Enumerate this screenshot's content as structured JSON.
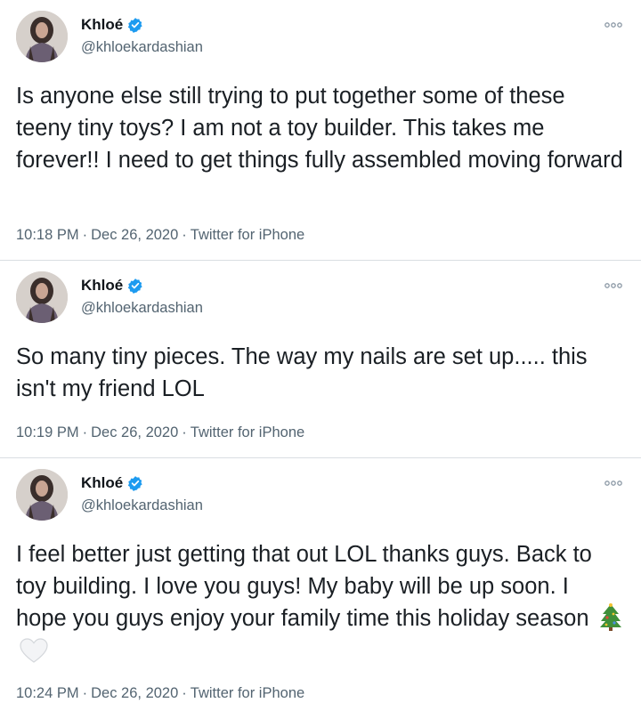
{
  "tweets": [
    {
      "author": "Khloé",
      "handle": "@khloekardashian",
      "text": "Is anyone else still trying to put together some of these teeny tiny toys? I am not a toy builder. This takes me forever!! I need to get things fully assembled moving forward",
      "time": "10:18 PM",
      "date": "Dec 26, 2020",
      "source": "Twitter for iPhone",
      "sep": "·"
    },
    {
      "author": "Khloé",
      "handle": "@khloekardashian",
      "text": "So many tiny pieces. The way my nails are set up..... this isn't my friend LOL",
      "time": "10:19 PM",
      "date": "Dec 26, 2020",
      "source": "Twitter for iPhone",
      "sep": "·"
    },
    {
      "author": "Khloé",
      "handle": "@khloekardashian",
      "text": "I feel better just getting that out LOL thanks guys. Back to toy building. I love you guys! My baby will be up soon. I hope you guys enjoy your family time this holiday season",
      "emojis": [
        "christmas-tree",
        "white-heart"
      ],
      "time": "10:24 PM",
      "date": "Dec 26, 2020",
      "source": "Twitter for iPhone",
      "sep": "·"
    }
  ],
  "colors": {
    "verified": "#1d9bf0",
    "muted": "#536471",
    "divider": "#d9dee2"
  }
}
